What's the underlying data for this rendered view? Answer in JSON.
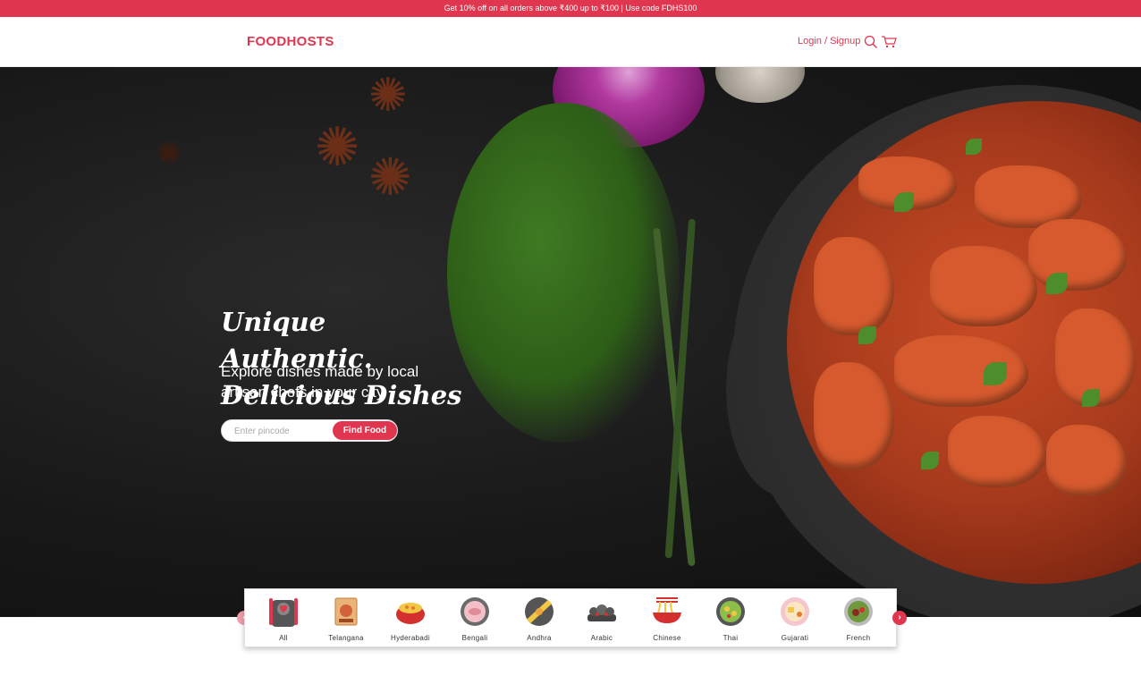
{
  "promo": {
    "text": "Get 10% off on all orders above ₹400 up to ₹100 | Use code FDHS100"
  },
  "header": {
    "logo": "FOODHOSTS",
    "login_label": "Login / Signup",
    "search_icon": "search-icon",
    "cart_icon": "cart-icon"
  },
  "hero": {
    "headline_line1": "Unique",
    "headline_line2": "Authentic.",
    "headline_line3": "Delicious Dishes",
    "subline": "Explore dishes made by local artisan chefs in your city",
    "pincode_placeholder": "Enter pincode",
    "pincode_value": "",
    "find_button": "Find Food"
  },
  "cuisines": {
    "items": [
      {
        "label": "All",
        "icon": "all-cuisines-icon"
      },
      {
        "label": "Telangana",
        "icon": "telangana-icon"
      },
      {
        "label": "Hyderabadi",
        "icon": "hyderabadi-icon"
      },
      {
        "label": "Bengali",
        "icon": "bengali-icon"
      },
      {
        "label": "Andhra",
        "icon": "andhra-icon"
      },
      {
        "label": "Arabic",
        "icon": "arabic-icon"
      },
      {
        "label": "Chinese",
        "icon": "chinese-icon"
      },
      {
        "label": "Thai",
        "icon": "thai-icon"
      },
      {
        "label": "Gujarati",
        "icon": "gujarati-icon"
      },
      {
        "label": "French",
        "icon": "french-icon"
      }
    ],
    "prev_icon": "chevron-left-icon",
    "next_icon": "chevron-right-icon"
  },
  "colors": {
    "brand": "#e0364f",
    "hero_bg": "#181818"
  }
}
